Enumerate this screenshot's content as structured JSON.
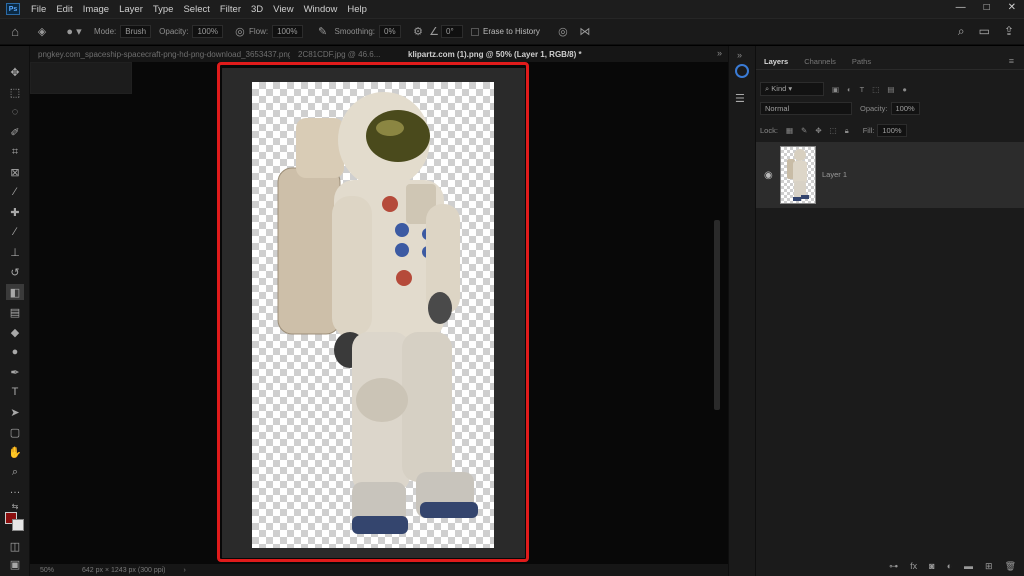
{
  "app": {
    "logo": "Ps"
  },
  "menu": [
    "File",
    "Edit",
    "Image",
    "Layer",
    "Type",
    "Select",
    "Filter",
    "3D",
    "View",
    "Window",
    "Help"
  ],
  "window_controls": [
    "—",
    "□",
    "✕"
  ],
  "options": {
    "mode_label": "Mode:",
    "mode_value": "Brush",
    "opacity_label": "Opacity:",
    "opacity_value": "100%",
    "flow_label": "Flow:",
    "flow_value": "100%",
    "smoothing_label": "Smoothing:",
    "smoothing_value": "0%",
    "angle_value": "0°",
    "erase_history_label": "Erase to History"
  },
  "tabs": [
    {
      "label": "pngkey.com_spaceship-spacecraft-png-hd-png-download_3653437.png",
      "active": false
    },
    {
      "label": "2C81CDF.jpg @ 46.6...",
      "active": false
    },
    {
      "label": "klipartz.com (1).png @ 50% (Layer 1, RGB/8) *",
      "active": true
    }
  ],
  "status": {
    "zoom": "50%",
    "doc_info": "642 px × 1243 px (300 ppi)"
  },
  "colors": {
    "highlight": "#e01b1b",
    "foreground": "#8b0e0e",
    "background": "#e7e7e7"
  },
  "layers_panel": {
    "tabs": [
      "Layers",
      "Channels",
      "Paths"
    ],
    "filter_label": "Kind",
    "blend_mode": "Normal",
    "opacity_label": "Opacity:",
    "opacity_value": "100%",
    "lock_label": "Lock:",
    "fill_label": "Fill:",
    "fill_value": "100%",
    "layers": [
      {
        "name": "Layer 1",
        "visible": true
      }
    ]
  }
}
